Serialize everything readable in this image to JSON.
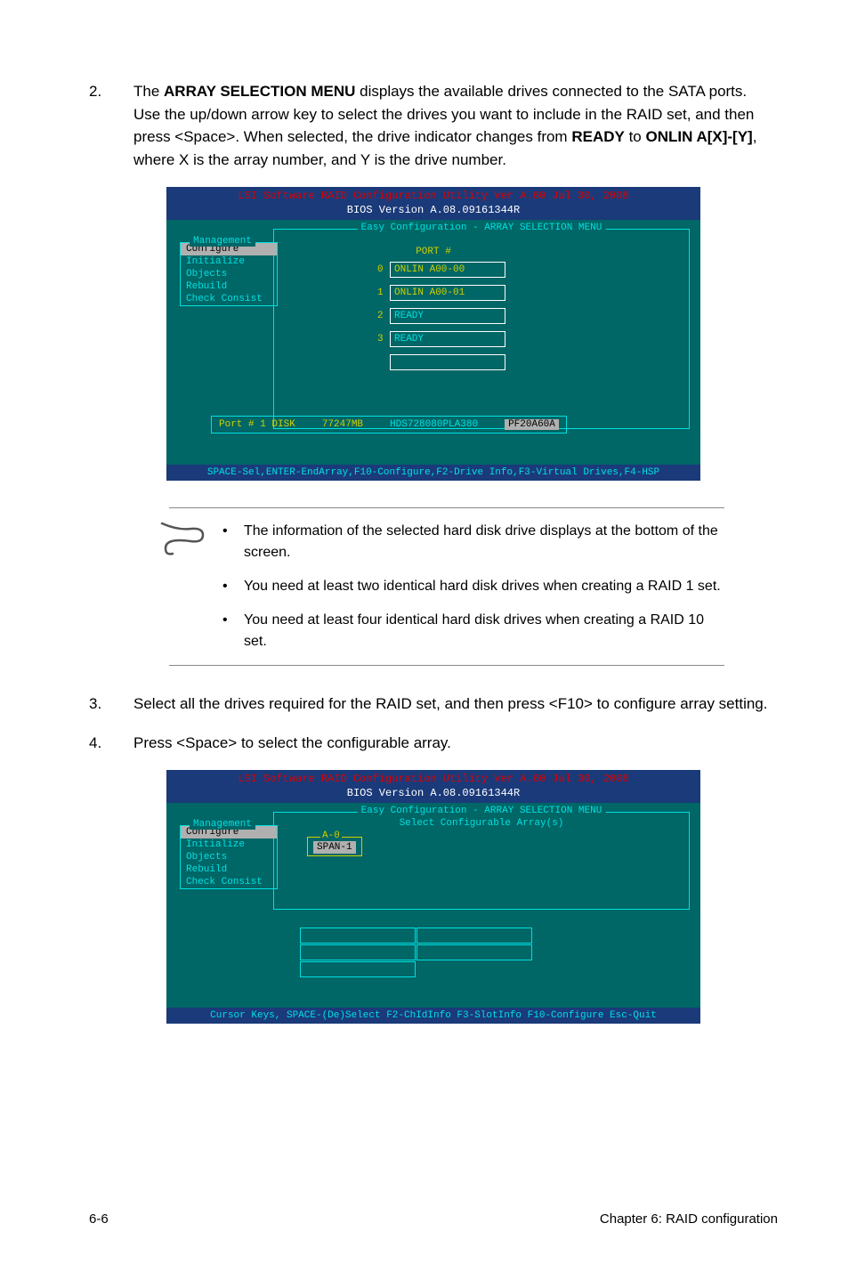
{
  "step2": {
    "num": "2.",
    "text_parts": {
      "p1": "The ",
      "b1": "ARRAY SELECTION MENU",
      "p2": " displays the available drives connected to the SATA ports. Use the up/down arrow key to select the drives you want to include in the RAID set, and then press <Space>. When selected, the drive indicator changes from ",
      "b2": "READY",
      "p3": " to ",
      "b3": "ONLIN A[X]-[Y]",
      "p4": ", where X is the array number, and Y is the drive number."
    }
  },
  "terminal1": {
    "head_l1": "LSI Software RAID Configuration Utility Ver A.60 Jul 30, 2008",
    "head_l2": "BIOS Version   A.08.09161344R",
    "frame_title": "Easy Configuration - ARRAY SELECTION MENU",
    "menu_title": "Management",
    "menu_items": [
      "Configure",
      "Initialize",
      "Objects",
      "Rebuild",
      "Check Consist"
    ],
    "port_header": "PORT #",
    "drives": [
      {
        "idx": "0",
        "label": "ONLIN A00-00",
        "cls": "onlin"
      },
      {
        "idx": "1",
        "label": "ONLIN A00-01",
        "cls": "onlin"
      },
      {
        "idx": "2",
        "label": "READY",
        "cls": ""
      },
      {
        "idx": "3",
        "label": "READY",
        "cls": ""
      }
    ],
    "port_info": {
      "port": "Port # 1 DISK",
      "size": "77247MB",
      "model": "HDS728080PLA380",
      "fw": "PF20A60A"
    },
    "foot": "SPACE-Sel,ENTER-EndArray,F10-Configure,F2-Drive Info,F3-Virtual Drives,F4-HSP"
  },
  "notes": [
    "The information of the selected hard disk drive displays at the bottom of the screen.",
    "You need at least two identical hard disk drives when creating a RAID 1 set.",
    "You need at least four identical hard disk drives when creating a RAID 10 set."
  ],
  "step3": {
    "num": "3.",
    "text": "Select all the drives required for the RAID set, and then press <F10> to configure array setting."
  },
  "step4": {
    "num": "4.",
    "text": "Press <Space> to select the configurable array."
  },
  "terminal2": {
    "head_l1": "LSI Software RAID Configuration Utility Ver A.60 Jul 30, 2008",
    "head_l2": "BIOS Version   A.08.09161344R",
    "frame_title": "Easy Configuration - ARRAY SELECTION MENU",
    "sub_title": "Select Configurable Array(s)",
    "menu_title": "Management",
    "menu_items": [
      "Configure",
      "Initialize",
      "Objects",
      "Rebuild",
      "Check Consist"
    ],
    "span_title": "A-0",
    "span_val": "SPAN-1",
    "foot": "Cursor Keys, SPACE-(De)Select F2-ChIdInfo F3-SlotInfo F10-Configure Esc-Quit"
  },
  "footer": {
    "left": "6-6",
    "right": "Chapter 6: RAID configuration"
  }
}
